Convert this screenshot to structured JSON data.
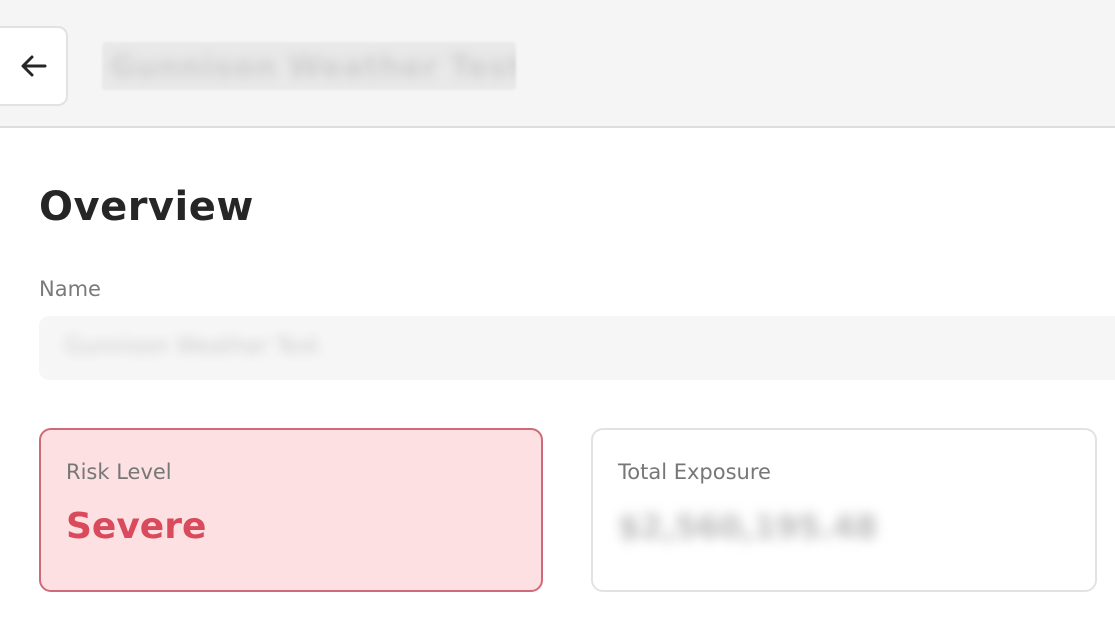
{
  "header": {
    "back_icon": "arrow-left-icon",
    "title": "Gunnison Weather Test"
  },
  "overview": {
    "heading": "Overview",
    "name_label": "Name",
    "name_value": "Gunnison Weather Test"
  },
  "cards": {
    "risk": {
      "label": "Risk Level",
      "value": "Severe",
      "accent_color": "#d94a5c",
      "background_color": "#fde0e1"
    },
    "exposure": {
      "label": "Total Exposure",
      "value": "$2,560,195.48"
    }
  }
}
